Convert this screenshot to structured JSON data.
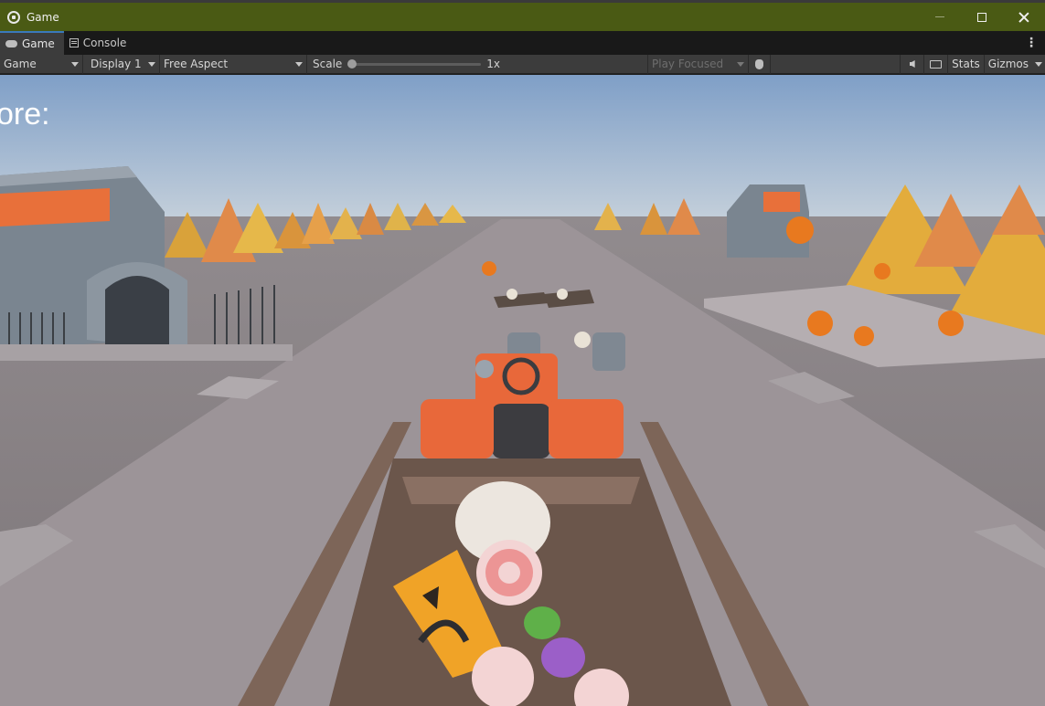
{
  "window": {
    "title": "Game",
    "icon": "unity-icon"
  },
  "tabs": [
    {
      "label": "Game",
      "icon": "gamepad-icon",
      "active": true
    },
    {
      "label": "Console",
      "icon": "console-icon",
      "active": false
    }
  ],
  "toolbar": {
    "view_mode": "Game",
    "display": "Display 1",
    "aspect": "Free Aspect",
    "scale_label": "Scale",
    "scale_value": "1x",
    "play_mode": "Play Focused",
    "stats_label": "Stats",
    "gizmos_label": "Gizmos"
  },
  "game": {
    "score_label": "ore:"
  },
  "colors": {
    "titlebar": "#4a5a14",
    "accent": "#3a79bb",
    "road": "#9c9498",
    "sky_top": "#7f9fc7",
    "kart": "#e8683a",
    "pumpkin": "#e8791f"
  }
}
